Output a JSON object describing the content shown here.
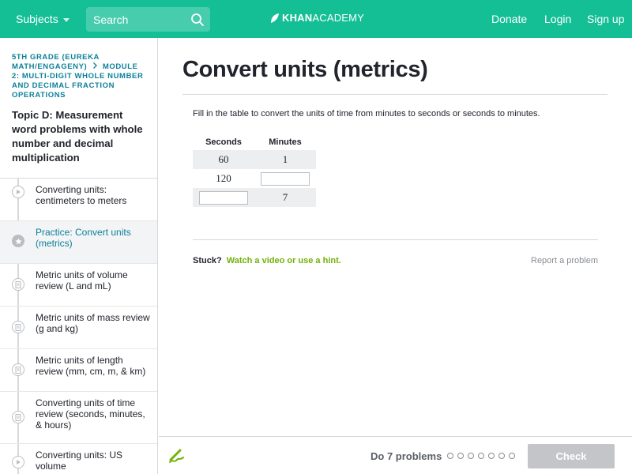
{
  "colors": {
    "header_bg": "#14bf96",
    "link_teal": "#0c7f99",
    "hint_green": "#71b307",
    "check_disabled": "#c3c5c8"
  },
  "header": {
    "subjects_label": "Subjects",
    "search_placeholder": "Search",
    "logo_khan": "KHAN",
    "logo_academy": "ACADEMY",
    "donate_label": "Donate",
    "login_label": "Login",
    "signup_label": "Sign up"
  },
  "sidebar": {
    "breadcrumb_part1": "5th grade (Eureka Math/EngageNY)",
    "breadcrumb_part2": "Module 2: Multi-digit whole number and decimal fraction operations",
    "topic_title": "Topic D: Measurement word problems with whole number and decimal multiplication",
    "items": [
      {
        "label": "Converting units: centimeters to meters",
        "icon": "play-icon",
        "active": false
      },
      {
        "label": "Practice: Convert units (metrics)",
        "icon": "star-icon",
        "active": true
      },
      {
        "label": "Metric units of volume review (L and mL)",
        "icon": "article-icon",
        "active": false
      },
      {
        "label": "Metric units of mass review (g and kg)",
        "icon": "article-icon",
        "active": false
      },
      {
        "label": "Metric units of length review (mm, cm, m, & km)",
        "icon": "article-icon",
        "active": false
      },
      {
        "label": "Converting units of time review (seconds, minutes, & hours)",
        "icon": "article-icon",
        "active": false
      },
      {
        "label": "Converting units: US volume",
        "icon": "play-icon",
        "active": false
      }
    ]
  },
  "main": {
    "title": "Convert units (metrics)",
    "question": "Fill in the table to convert the units of time from minutes to seconds or seconds to minutes.",
    "table": {
      "headers": [
        "Seconds",
        "Minutes"
      ],
      "rows": [
        {
          "seconds": "60",
          "minutes": "1"
        },
        {
          "seconds": "120",
          "minutes": ""
        },
        {
          "seconds": "",
          "minutes": "7"
        }
      ]
    },
    "stuck_label": "Stuck?",
    "hint_link": "Watch a video or use a hint.",
    "report_link": "Report a problem"
  },
  "footer": {
    "scratchpad_icon": "pencil-icon",
    "do_problems": "Do 7 problems",
    "progress_total": 7,
    "progress_done": 0,
    "check_label": "Check"
  }
}
